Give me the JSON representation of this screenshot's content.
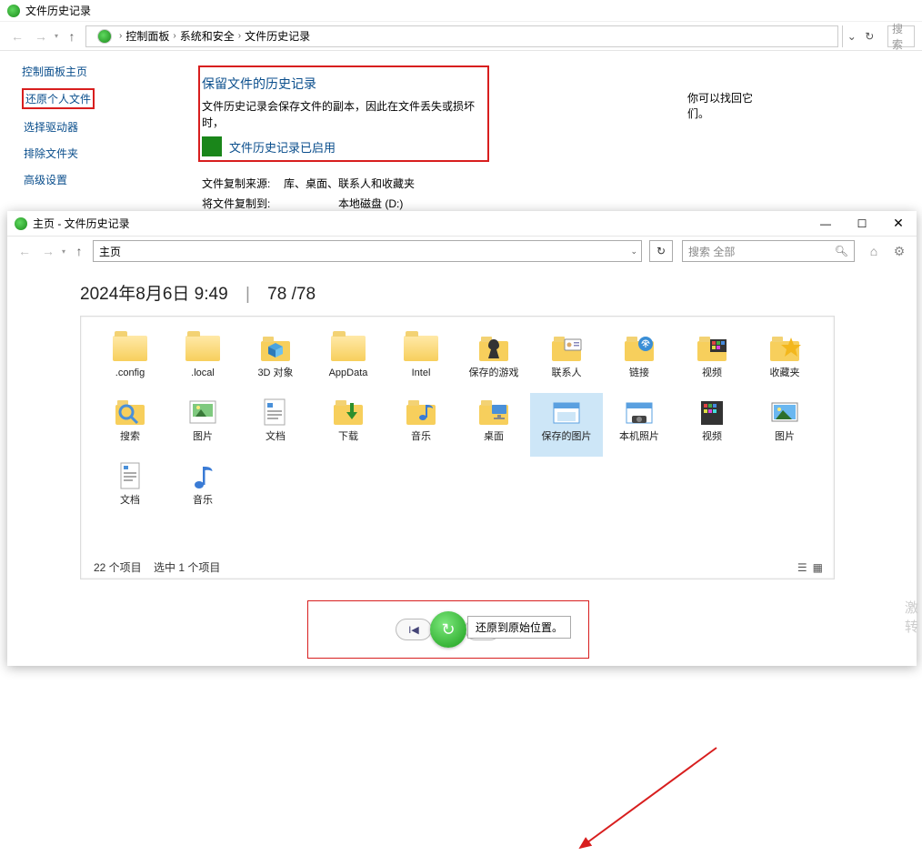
{
  "win1": {
    "title": "文件历史记录",
    "breadcrumb": [
      "控制面板",
      "系统和安全",
      "文件历史记录"
    ],
    "search_placeholder": "搜索",
    "sidebar": {
      "header": "控制面板主页",
      "items": [
        "还原个人文件",
        "选择驱动器",
        "排除文件夹",
        "高级设置"
      ]
    },
    "content": {
      "heading": "保留文件的历史记录",
      "desc_a": "文件历史记录会保存文件的副本，因此在文件丢失或损坏时，",
      "desc_b": "你可以找回它们。",
      "status": "文件历史记录已启用",
      "row1k": "文件复制来源:",
      "row1v": "库、桌面、联系人和收藏夹",
      "row2k": "将文件复制到:",
      "row2v": "本地磁盘 (D:)"
    }
  },
  "win2": {
    "title": "主页 - 文件历史记录",
    "addr": "主页",
    "search_placeholder": "搜索 全部",
    "datestamp": "2024年8月6日 9:49",
    "page_current": "78",
    "page_total": "78",
    "items": [
      {
        "label": ".config",
        "icon": "folder"
      },
      {
        "label": ".local",
        "icon": "folder"
      },
      {
        "label": "3D 对象",
        "icon": "folder-3d"
      },
      {
        "label": "AppData",
        "icon": "folder"
      },
      {
        "label": "Intel",
        "icon": "folder"
      },
      {
        "label": "保存的游戏",
        "icon": "folder-games"
      },
      {
        "label": "联系人",
        "icon": "folder-contacts"
      },
      {
        "label": "链接",
        "icon": "folder-links"
      },
      {
        "label": "视频",
        "icon": "folder-video"
      },
      {
        "label": "收藏夹",
        "icon": "folder-fav"
      },
      {
        "label": "搜索",
        "icon": "folder-search"
      },
      {
        "label": "图片",
        "icon": "pictures"
      },
      {
        "label": "文档",
        "icon": "documents"
      },
      {
        "label": "下载",
        "icon": "folder-down"
      },
      {
        "label": "音乐",
        "icon": "folder-music"
      },
      {
        "label": "桌面",
        "icon": "folder-desktop"
      },
      {
        "label": "保存的图片",
        "icon": "saved-pic",
        "selected": true
      },
      {
        "label": "本机照片",
        "icon": "cam-photo"
      },
      {
        "label": "视频",
        "icon": "video-file"
      },
      {
        "label": "图片",
        "icon": "picture-file"
      },
      {
        "label": "文档",
        "icon": "doc-file"
      },
      {
        "label": "音乐",
        "icon": "music-file"
      }
    ],
    "footer_count": "22 个项目",
    "footer_selected": "选中 1 个项目",
    "tooltip": "还原到原始位置。",
    "watermark_lines": [
      "激",
      "转"
    ]
  }
}
